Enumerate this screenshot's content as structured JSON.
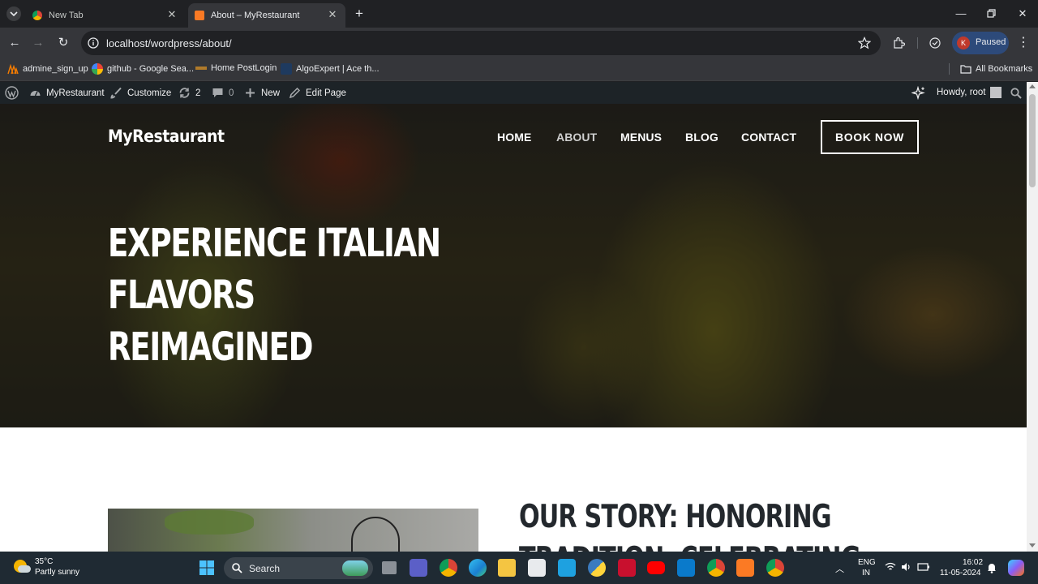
{
  "browser": {
    "tabs": [
      {
        "title": "New Tab",
        "icon": "chrome-icon",
        "active": false
      },
      {
        "title": "About – MyRestaurant",
        "icon": "xampp-icon",
        "active": true
      }
    ],
    "url": "localhost/wordpress/about/",
    "profile_initial": "K",
    "profile_status": "Paused",
    "bookmarks": [
      {
        "label": "admine_sign_up"
      },
      {
        "label": "github - Google Sea..."
      },
      {
        "label": "Home PostLogin"
      },
      {
        "label": "AlgoExpert | Ace th..."
      }
    ],
    "all_bookmarks": "All Bookmarks"
  },
  "admin_bar": {
    "site_name": "MyRestaurant",
    "customize": "Customize",
    "updates_count": "2",
    "comments_count": "0",
    "new_label": "New",
    "edit_label": "Edit Page",
    "howdy": "Howdy, root"
  },
  "site": {
    "title": "MyRestaurant",
    "menu": [
      "HOME",
      "ABOUT",
      "MENUS",
      "BLOG",
      "CONTACT"
    ],
    "active_menu": "ABOUT",
    "cta": "BOOK NOW",
    "hero_line1": "EXPERIENCE ITALIAN FLAVORS",
    "hero_line2": "REIMAGINED",
    "story_line1": "OUR STORY: HONORING",
    "story_line2": "TRADITION, CELEBRATING"
  },
  "taskbar": {
    "temperature": "35°C",
    "weather": "Partly sunny",
    "search_label": "Search",
    "lang_line1": "ENG",
    "lang_line2": "IN",
    "time": "16:02",
    "date": "11-05-2024"
  },
  "colors": {
    "browser_bg": "#202124",
    "toolbar_bg": "#35363a",
    "admin_bar_bg": "#1d2327",
    "taskbar_bg": "#1f2a33",
    "story_heading": "#23282d"
  }
}
